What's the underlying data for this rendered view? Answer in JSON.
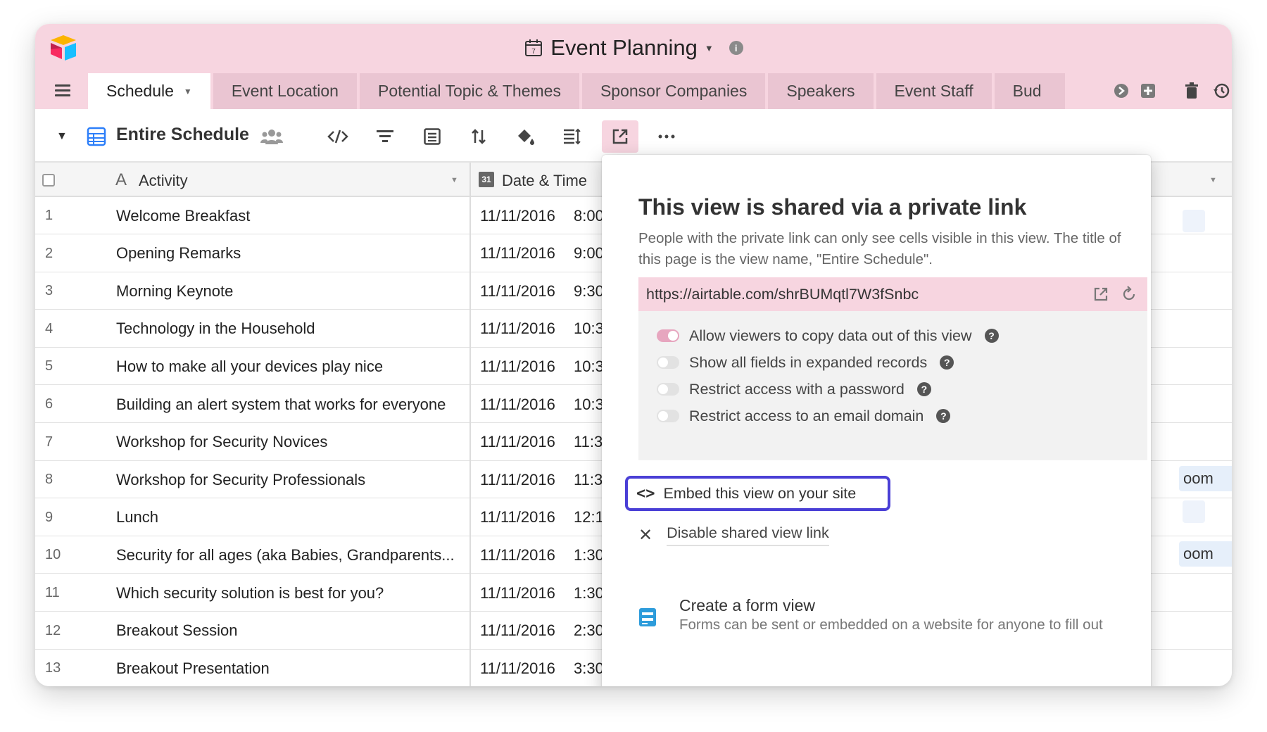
{
  "base": {
    "title": "Event Planning"
  },
  "tabs": [
    {
      "label": "Schedule",
      "active": true
    },
    {
      "label": "Event Location"
    },
    {
      "label": "Potential Topic & Themes"
    },
    {
      "label": "Sponsor Companies"
    },
    {
      "label": "Speakers"
    },
    {
      "label": "Event Staff"
    },
    {
      "label": "Bud"
    }
  ],
  "toolbar": {
    "view_name": "Entire Schedule"
  },
  "columns": {
    "activity": "Activity",
    "date_time": "Date & Time"
  },
  "rows": [
    {
      "num": "1",
      "activity": "Welcome Breakfast",
      "date": "11/11/2016",
      "time": "8:00"
    },
    {
      "num": "2",
      "activity": "Opening Remarks",
      "date": "11/11/2016",
      "time": "9:00"
    },
    {
      "num": "3",
      "activity": "Morning Keynote",
      "date": "11/11/2016",
      "time": "9:30"
    },
    {
      "num": "4",
      "activity": "Technology in the Household",
      "date": "11/11/2016",
      "time": "10:3"
    },
    {
      "num": "5",
      "activity": "How to make all your devices play nice",
      "date": "11/11/2016",
      "time": "10:3"
    },
    {
      "num": "6",
      "activity": "Building an alert system that works for everyone",
      "date": "11/11/2016",
      "time": "10:3"
    },
    {
      "num": "7",
      "activity": "Workshop for Security Novices",
      "date": "11/11/2016",
      "time": "11:3"
    },
    {
      "num": "8",
      "activity": "Workshop for Security Professionals",
      "date": "11/11/2016",
      "time": "11:3"
    },
    {
      "num": "9",
      "activity": "Lunch",
      "date": "11/11/2016",
      "time": "12:1"
    },
    {
      "num": "10",
      "activity": "Security for all ages (aka Babies, Grandparents...",
      "date": "11/11/2016",
      "time": "1:30"
    },
    {
      "num": "11",
      "activity": "Which security solution is best for you?",
      "date": "11/11/2016",
      "time": "1:30"
    },
    {
      "num": "12",
      "activity": "Breakout Session",
      "date": "11/11/2016",
      "time": "2:30"
    },
    {
      "num": "13",
      "activity": "Breakout Presentation",
      "date": "11/11/2016",
      "time": "3:30"
    }
  ],
  "side_pill_text": "oom",
  "share": {
    "title": "This view is shared via a private link",
    "description": "People with the private link can only see cells visible in this view. The title of this page is the view name, \"Entire Schedule\".",
    "url": "https://airtable.com/shrBUMqtl7W3fSnbc",
    "options": [
      {
        "label": "Allow viewers to copy data out of this view",
        "enabled": true
      },
      {
        "label": "Show all fields in expanded records",
        "enabled": false
      },
      {
        "label": "Restrict access with a password",
        "enabled": false
      },
      {
        "label": "Restrict access to an email domain",
        "enabled": false
      }
    ],
    "embed_label": "Embed this view on your site",
    "disable_label": "Disable shared view link",
    "form_title": "Create a form view",
    "form_desc": "Forms can be sent or embedded on a website for anyone to fill out"
  },
  "colors": {
    "header_bg": "#f7d5e0",
    "tab_bg": "#eac5d2",
    "highlight_border": "#4a3fd6",
    "toggle_on": "#e7a6bf",
    "grid_icon_blue": "#2d7ff9"
  }
}
